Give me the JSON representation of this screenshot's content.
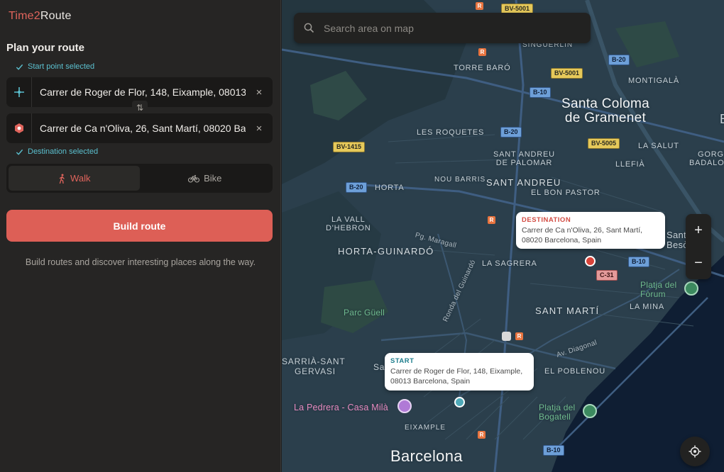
{
  "brand": {
    "part1": "Time2",
    "part2": "Route"
  },
  "panel": {
    "title": "Plan your route",
    "start_status": "Start point selected",
    "destination_status": "Destination selected",
    "start_value": "Carrer de Roger de Flor, 148, Eixample, 08013 Barcelona, Spain",
    "destination_value": "Carrer de Ca n'Oliva, 26, Sant Martí, 08020 Barcelona, Spain",
    "clear_symbol": "×",
    "swap_symbol": "⇅",
    "modes": [
      {
        "label": "Walk",
        "icon": "walk-icon",
        "active": true
      },
      {
        "label": "Bike",
        "icon": "bike-icon",
        "active": false
      }
    ],
    "build_label": "Build route",
    "hint": "Build routes and discover interesting places along the way."
  },
  "map": {
    "search_placeholder": "Search area on map",
    "zoom_in": "+",
    "zoom_out": "−",
    "destination_callout": {
      "title": "DESTINATION",
      "line1": "Carrer de Ca n'Oliva, 26, Sant Martí,",
      "line2": "08020 Barcelona, Spain"
    },
    "start_callout": {
      "title": "START",
      "line1": "Carrer de Roger de Flor, 148, Eixample,",
      "line2": "08013 Barcelona, Spain"
    },
    "labels": {
      "santa_coloma_1": "Santa Coloma",
      "santa_coloma_2": "de Gramenet",
      "barcelona": "Barcelona",
      "singuerlin": "SINGUERLIN",
      "torre_baro": "TORRE BARÓ",
      "montigala": "MONTIGALÀ",
      "les_roquetes": "LES ROQUETES",
      "sant_andreu_palomar_1": "SANT ANDREU",
      "sant_andreu_palomar_2": "DE PALOMAR",
      "la_salut": "LA SALUT",
      "gorg": "GORG",
      "badalo": "BADALO",
      "llefia": "LLEFIÀ",
      "nou_barris": "NOU BARRIS",
      "sant_andreu": "SANT ANDREU",
      "horta": "HORTA",
      "el_bon_pastor": "EL BON PASTOR",
      "la_vall_1": "LA VALL",
      "la_vall_2": "D'HEBRON",
      "horta_guinardo": "HORTA-GUINARDÓ",
      "pg_maragall": "Pg. Maragall",
      "la_sagrera": "LA SAGRERA",
      "sant_adria_1": "Sant Adriá",
      "sant_adria_2": "Besòs",
      "platja_forum_1": "Platja del",
      "platja_forum_2": "Fòrum",
      "la_mina": "LA MINA",
      "parc_guell": "Parc Güell",
      "ronda_guinardo": "Ronda del Guinardó",
      "sant_marti": "SANT MARTÍ",
      "av_diagonal": "Av. Diagonal",
      "sarria_1": "SARRIÀ-SANT",
      "sarria_2": "GERVASI",
      "sa": "Sa",
      "el_poblenou": "EL POBLENOU",
      "la_pedrera": "La Pedrera - Casa Milà",
      "platja_bogatell_1": "Platja del",
      "platja_bogatell_2": "Bogatell",
      "eixample": "EIXAMPLE",
      "e_edge": "E"
    },
    "shields": {
      "bv5001_top": "BV-5001",
      "bv5001": "BV-5001",
      "b20_a": "B-20",
      "b20_b": "B-20",
      "b20_c": "B-20",
      "b10_a": "B-10",
      "b10_b": "B-10",
      "b10_c": "B-10",
      "bv1415": "BV-1415",
      "bv5005": "BV-5005",
      "c31": "C-31",
      "poi_r": "R"
    },
    "colors": {
      "accent": "#dd5f56",
      "start": "#4fa9b8",
      "destination": "#d8443a",
      "map_land": "#2b3f4c",
      "map_water": "#0f1e33"
    }
  }
}
